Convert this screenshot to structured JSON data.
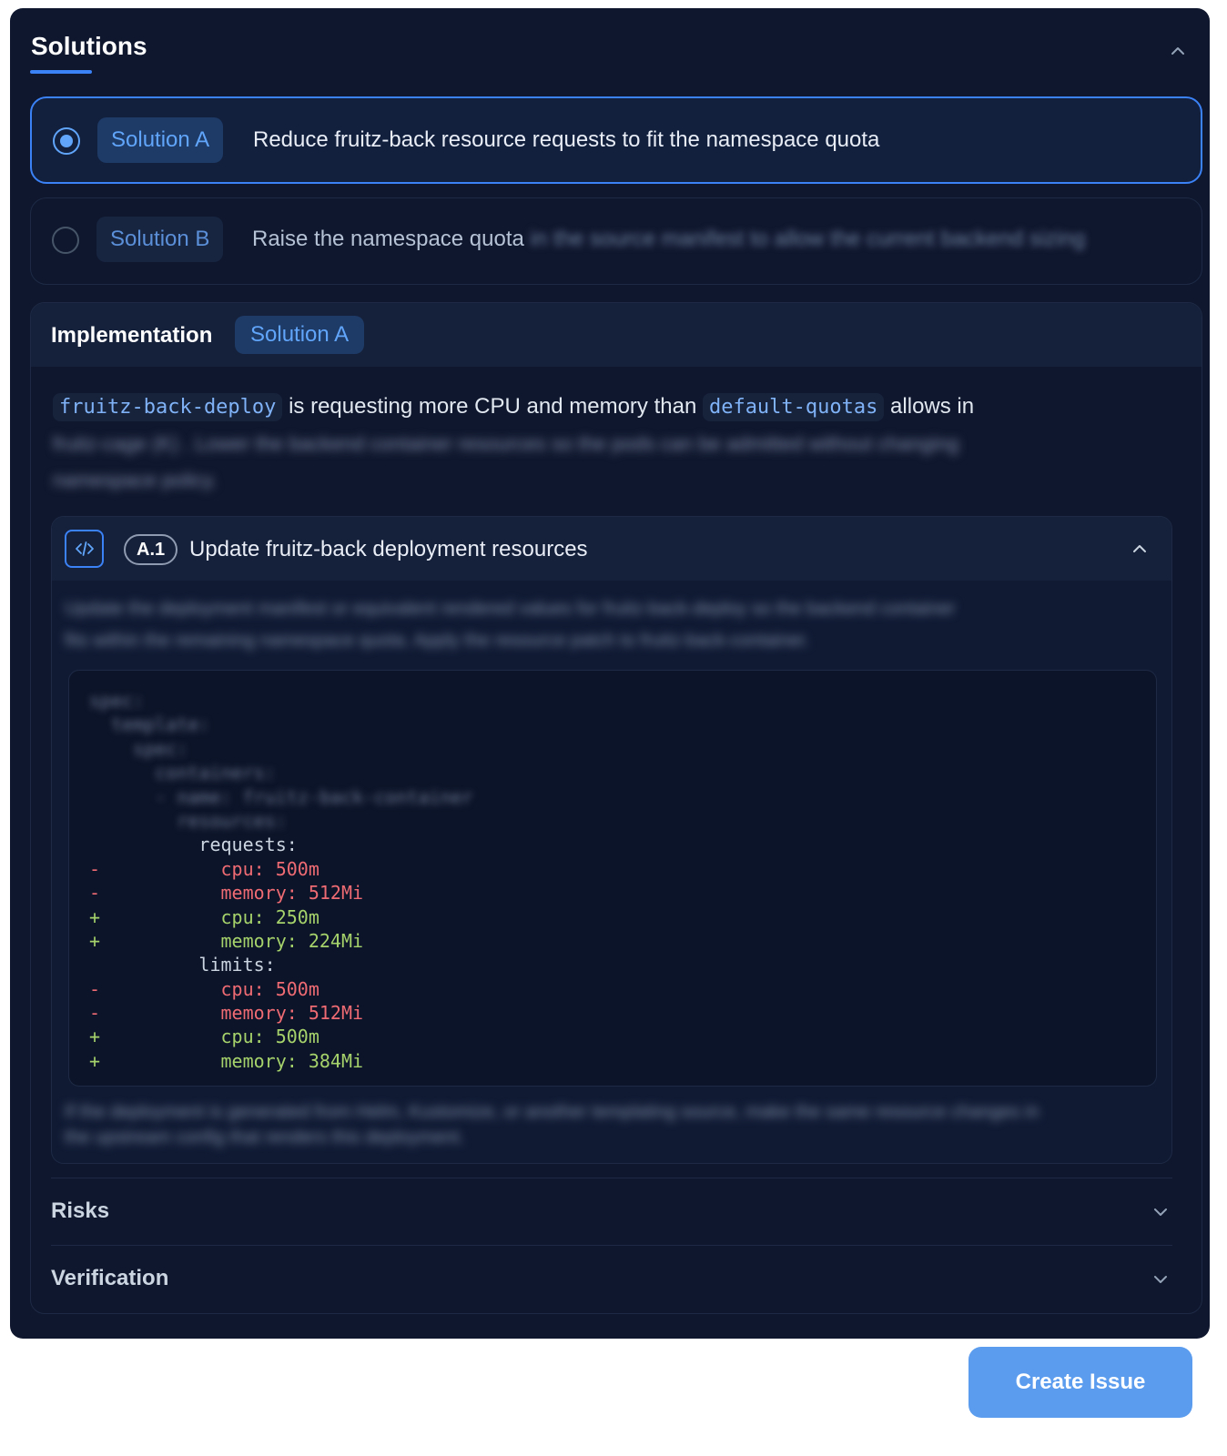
{
  "panel": {
    "title": "Solutions"
  },
  "solutions": [
    {
      "tag": "Solution A",
      "text": "Reduce fruitz-back resource requests to fit the namespace quota",
      "selected": true,
      "blurred_suffix": ""
    },
    {
      "tag": "Solution B",
      "text": "Raise the namespace quota",
      "selected": false,
      "blurred_suffix": "in the source manifest to allow the current backend sizing"
    }
  ],
  "implementation": {
    "title": "Implementation",
    "tag": "Solution A",
    "desc": {
      "code1": "fruitz-back-deploy",
      "text1": " is requesting more CPU and memory than ",
      "code2": "default-quotas",
      "text2": " allows in",
      "blur_line1": "fruitz-cage (K) . Lower the backend container resources so the pods can be admitted without changing",
      "blur_line2": "namespace policy."
    },
    "step": {
      "badge": "A.1",
      "title": "Update fruitz-back deployment resources",
      "intro_line1": "Update the deployment manifest or equivalent rendered values for fruitz-back-deploy so the backend container",
      "intro_line2": "fits within the remaining namespace quota. Apply the resource patch to fruitz-back-container.",
      "code": {
        "blurred": [
          "spec:",
          "  template:",
          "    spec:",
          "      containers:",
          "      - name: fruitz-back-container",
          "        resources:"
        ],
        "lines": [
          {
            "sign": " ",
            "type": "ctx",
            "text": "          requests:"
          },
          {
            "sign": "-",
            "type": "del",
            "text": "            cpu: 500m"
          },
          {
            "sign": "-",
            "type": "del",
            "text": "            memory: 512Mi"
          },
          {
            "sign": "+",
            "type": "add",
            "text": "            cpu: 250m"
          },
          {
            "sign": "+",
            "type": "add",
            "text": "            memory: 224Mi"
          },
          {
            "sign": " ",
            "type": "ctx",
            "text": "          limits:"
          },
          {
            "sign": "-",
            "type": "del",
            "text": "            cpu: 500m"
          },
          {
            "sign": "-",
            "type": "del",
            "text": "            memory: 512Mi"
          },
          {
            "sign": "+",
            "type": "add",
            "text": "            cpu: 500m"
          },
          {
            "sign": "+",
            "type": "add",
            "text": "            memory: 384Mi"
          }
        ]
      },
      "outro_line1": "If the deployment is generated from Helm, Kustomize, or another templating source, make the same resource changes in",
      "outro_line2": "the upstream config that renders this deployment."
    },
    "sections": [
      {
        "label": "Risks"
      },
      {
        "label": "Verification"
      }
    ]
  },
  "actions": {
    "create_issue": "Create Issue"
  },
  "colors": {
    "panel_bg": "#0f172e",
    "accent": "#3b82f6",
    "diff_removed": "#ef6b73",
    "diff_added": "#a6d26b",
    "button": "#5b9cee"
  }
}
